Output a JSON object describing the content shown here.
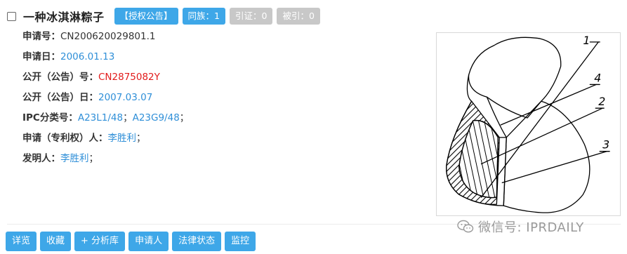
{
  "record": {
    "title": "一种冰淇淋粽子",
    "badges": {
      "grant": "【授权公告】",
      "family": "同族：1",
      "cited": "引证：0",
      "cited_by": "被引：0"
    },
    "fields": {
      "app_no_label": "申请号：",
      "app_no": "CN200620029801.1",
      "app_date_label": "申请日：",
      "app_date": "2006.01.13",
      "pub_no_label": "公开（公告）号：",
      "pub_no": "CN2875082Y",
      "pub_date_label": "公开（公告）日：",
      "pub_date": "2007.03.07",
      "ipc_label": "IPC分类号：",
      "ipc_1": "A23L1/48",
      "ipc_sep": "；",
      "ipc_2": "A23G9/48",
      "ipc_end": "；",
      "applicant_label": "申请（专利权）人：",
      "applicant": "李胜利",
      "applicant_end": "；",
      "inventor_label": "发明人：",
      "inventor": "李胜利",
      "inventor_end": "；"
    },
    "figure_labels": [
      "1",
      "4",
      "2",
      "3"
    ]
  },
  "actions": {
    "detail": "详览",
    "favorite": "收藏",
    "analysis": "+ 分析库",
    "applicant": "申请人",
    "legal_status": "法律状态",
    "monitor": "监控"
  },
  "watermark": {
    "text": "微信号: IPRDAILY",
    "icon": "wechat-icon"
  },
  "colors": {
    "accent": "#3ea7e8",
    "link": "#2f8fd8",
    "pub_no": "#e21b1b",
    "badge_disabled": "#c8c8c8"
  }
}
